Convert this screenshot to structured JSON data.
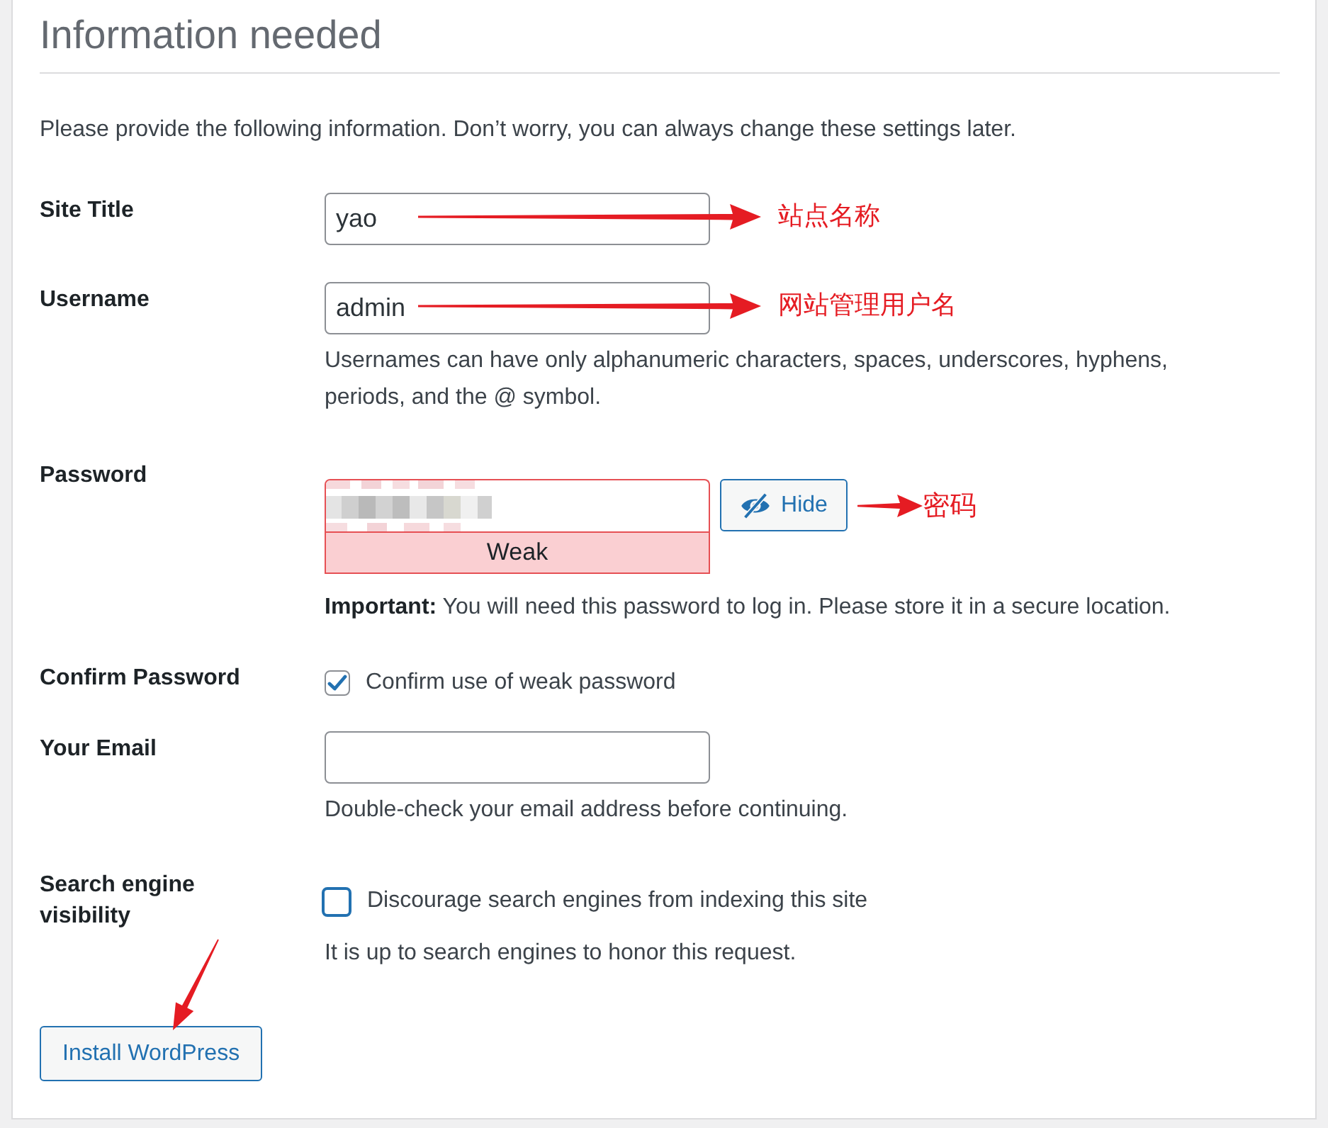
{
  "heading": "Information needed",
  "intro": "Please provide the following information. Don’t worry, you can always change these settings later.",
  "fields": [
    {
      "kind": "text",
      "label": "Site Title",
      "value": "yao",
      "annotation": "站点名称"
    },
    {
      "kind": "text",
      "label": "Username",
      "value": "admin",
      "hint": "Usernames can have only alphanumeric characters, spaces, underscores, hyphens, periods, and the @ symbol.",
      "annotation": "网站管理用户名"
    },
    {
      "kind": "password",
      "label": "Password",
      "strength": "Weak",
      "toggle_button": "Hide",
      "note": "**Important:** You will need this password to log in. Please store it in a secure location.",
      "annotation": "密码"
    },
    {
      "kind": "checkbox",
      "label": "Confirm Password",
      "option": "Confirm use of weak password",
      "checked": true
    },
    {
      "kind": "text",
      "label": "Your Email",
      "hint": "Double-check your email address before continuing."
    },
    {
      "kind": "checkbox",
      "label": "Search engine visibility",
      "option": "Discourage search engines from indexing this site",
      "checked": false,
      "hint": "It is up to search engines to honor this request."
    }
  ],
  "submit_button": "Install WordPress"
}
